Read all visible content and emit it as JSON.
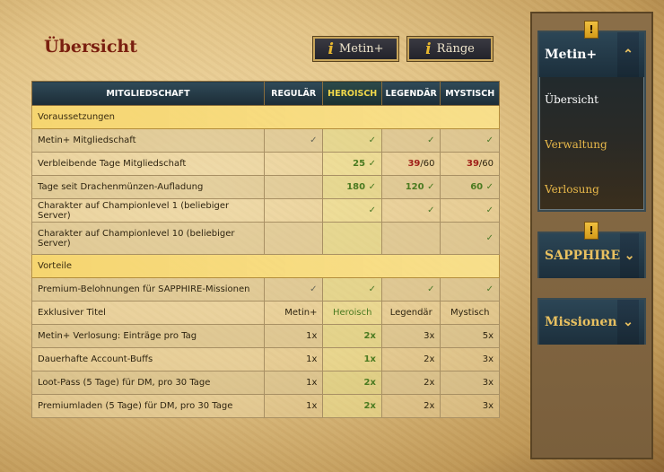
{
  "page": {
    "title": "Übersicht"
  },
  "buttons": {
    "info_icon": "i",
    "metin_plus": "Metin+",
    "raenge": "Ränge"
  },
  "table": {
    "headers": [
      "MITGLIEDSCHAFT",
      "REGULÄR",
      "HEROISCH",
      "LEGENDÄR",
      "MYSTISCH"
    ],
    "sections": {
      "voraussetzungen": "Voraussetzungen",
      "vorteile": "Vorteile"
    },
    "check": "✓",
    "req_rows": [
      {
        "label": "Metin+ Mitgliedschaft",
        "cells": [
          "✓",
          "✓",
          "✓",
          "✓"
        ]
      },
      {
        "label": "Verbleibende Tage Mitgliedschaft",
        "cells": [
          "",
          "25 ✓",
          "39/60",
          "39/60"
        ]
      },
      {
        "label": "Tage seit Drachenmünzen-Aufladung",
        "cells": [
          "",
          "180 ✓",
          "120 ✓",
          "60 ✓"
        ]
      },
      {
        "label": "Charakter auf Championlevel 1 (beliebiger Server)",
        "cells": [
          "",
          "✓",
          "✓",
          "✓"
        ]
      },
      {
        "label": "Charakter auf Championlevel 10 (beliebiger Server)",
        "cells": [
          "",
          "",
          "",
          "✓"
        ]
      }
    ],
    "red_numbers": {
      "legendaer": "39",
      "mystisch": "39",
      "suffix": "/60"
    },
    "benefit_rows": [
      {
        "label": "Premium-Belohnungen für SAPPHIRE-Missionen",
        "cells": [
          "✓",
          "✓",
          "✓",
          "✓"
        ]
      },
      {
        "label": "Exklusiver Titel",
        "cells": [
          "Metin+",
          "Heroisch",
          "Legendär",
          "Mystisch"
        ]
      },
      {
        "label": "Metin+ Verlosung: Einträge pro Tag",
        "cells": [
          "1x",
          "2x",
          "3x",
          "5x"
        ]
      },
      {
        "label": "Dauerhafte Account-Buffs",
        "cells": [
          "1x",
          "1x",
          "2x",
          "3x"
        ]
      },
      {
        "label": "Loot-Pass (5 Tage) für DM, pro 30 Tage",
        "cells": [
          "1x",
          "2x",
          "2x",
          "3x"
        ]
      },
      {
        "label": "Premiumladen (5 Tage) für DM, pro 30 Tage",
        "cells": [
          "1x",
          "2x",
          "2x",
          "3x"
        ]
      }
    ]
  },
  "sidebar": {
    "badge": "!",
    "panels": [
      {
        "title": "Metin+",
        "expanded": true,
        "items": [
          "Übersicht",
          "Verwaltung",
          "Verlosung"
        ]
      },
      {
        "title": "SAPPHIRE",
        "expanded": false
      },
      {
        "title": "Missionen",
        "expanded": false
      }
    ],
    "chevron_up": "⌃",
    "chevron_down": "⌄"
  },
  "colors": {
    "title_red": "#7a1f10",
    "header_dark": "#1c2c36",
    "gold": "#e8c060",
    "check_green": "#4d7a2a",
    "red_value": "#a0201a"
  }
}
